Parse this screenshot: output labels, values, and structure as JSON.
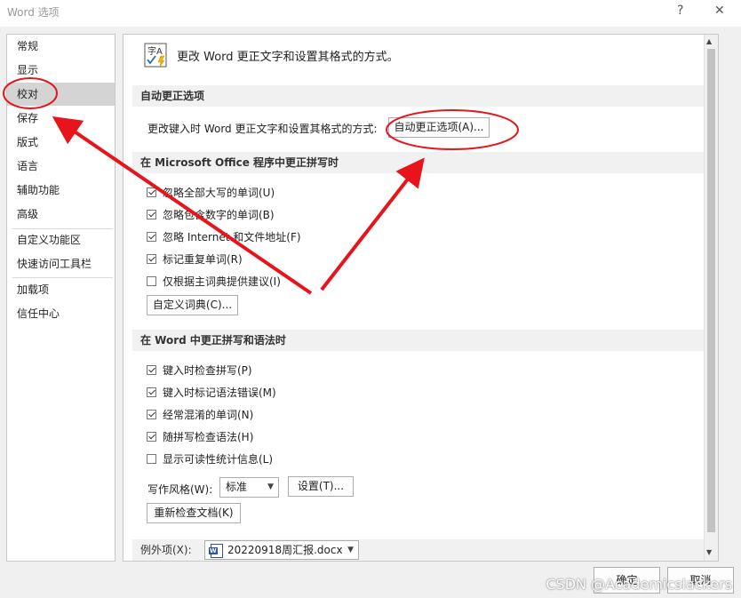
{
  "window": {
    "title": "Word 选项",
    "help": "?",
    "close": "✕"
  },
  "sidebar": {
    "items": [
      {
        "label": "常规"
      },
      {
        "label": "显示"
      },
      {
        "label": "校对"
      },
      {
        "label": "保存"
      },
      {
        "label": "版式"
      },
      {
        "label": "语言"
      },
      {
        "label": "辅助功能"
      },
      {
        "label": "高级"
      },
      {
        "label": "自定义功能区"
      },
      {
        "label": "快速访问工具栏"
      },
      {
        "label": "加载项"
      },
      {
        "label": "信任中心"
      }
    ],
    "selected": "校对"
  },
  "main": {
    "header_icon_text": "字A",
    "header": "更改 Word 更正文字和设置其格式的方式。",
    "autocorrect": {
      "section": "自动更正选项",
      "text": "更改键入时 Word 更正文字和设置其格式的方式:",
      "button": "自动更正选项(A)..."
    },
    "office_spelling": {
      "section": "在 Microsoft Office 程序中更正拼写时",
      "options": [
        {
          "label": "忽略全部大写的单词(U)",
          "checked": true
        },
        {
          "label": "忽略包含数字的单词(B)",
          "checked": true
        },
        {
          "label": "忽略 Internet 和文件地址(F)",
          "checked": true
        },
        {
          "label": "标记重复单词(R)",
          "checked": true
        },
        {
          "label": "仅根据主词典提供建议(I)",
          "checked": false
        }
      ],
      "custom_dict_button": "自定义词典(C)..."
    },
    "word_spelling": {
      "section": "在 Word 中更正拼写和语法时",
      "options": [
        {
          "label": "键入时检查拼写(P)",
          "checked": true
        },
        {
          "label": "键入时标记语法错误(M)",
          "checked": true
        },
        {
          "label": "经常混淆的单词(N)",
          "checked": true
        },
        {
          "label": "随拼写检查语法(H)",
          "checked": true
        },
        {
          "label": "显示可读性统计信息(L)",
          "checked": false
        }
      ],
      "writing_style_label": "写作风格(W):",
      "writing_style_value": "标准",
      "settings_button": "设置(T)...",
      "recheck_button": "重新检查文档(K)"
    },
    "exceptions": {
      "label": "例外项(X):",
      "file": "20220918周汇报.docx"
    }
  },
  "footer": {
    "ok": "确定",
    "cancel": "取消"
  },
  "watermark": "CSDN @Academicslackers",
  "colors": {
    "annotation": "#e8141b",
    "selected_bg": "#d4d4d4",
    "section_bg": "#f1f1f1"
  }
}
